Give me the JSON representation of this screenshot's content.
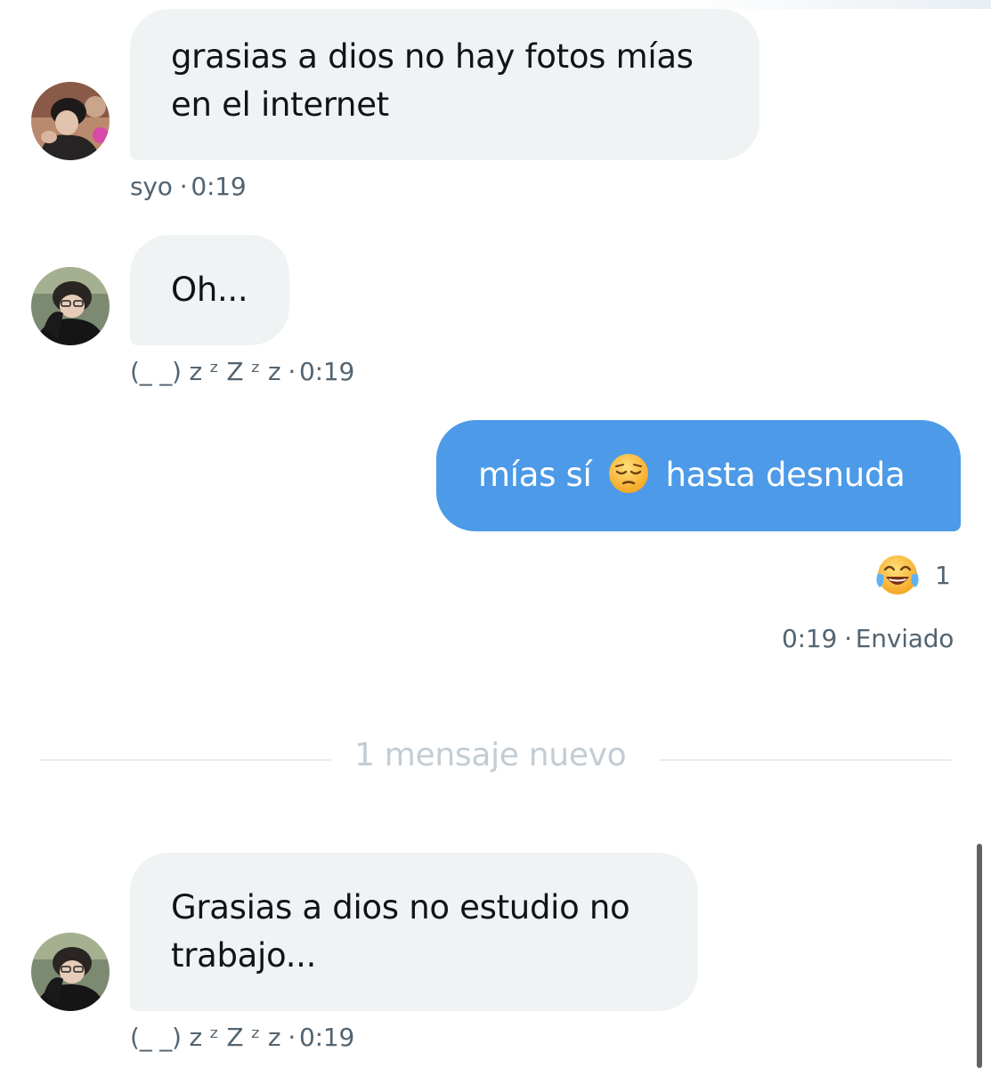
{
  "messages": [
    {
      "text_line1": "grasias a dios no hay fotos mías",
      "text_line2": "en el internet",
      "sender": "syo",
      "time": "0:19"
    },
    {
      "text": "Oh...",
      "sender": "(_ _) z ᶻ Z ᶻ z",
      "time": "0:19"
    },
    {
      "text_before": "mías sí",
      "emoji_name": "pensive-face-emoji",
      "text_after": "hasta desnuda",
      "reaction_count": "1",
      "reaction_emoji": "face-with-tears-of-joy-emoji",
      "time": "0:19",
      "status": "Enviado"
    },
    {
      "text_line1": "Grasias a dios no estudio no",
      "text_line2": "trabajo...",
      "sender": "(_ _) z ᶻ Z ᶻ z",
      "time": "0:19"
    }
  ],
  "divider": {
    "label": "1 mensaje nuevo"
  },
  "meta_separator": "·",
  "colors": {
    "incoming_bubble": "#eff3f4",
    "outgoing_bubble": "#4c9ae8",
    "meta_text": "#536471",
    "divider_text": "#c3ccd3"
  }
}
